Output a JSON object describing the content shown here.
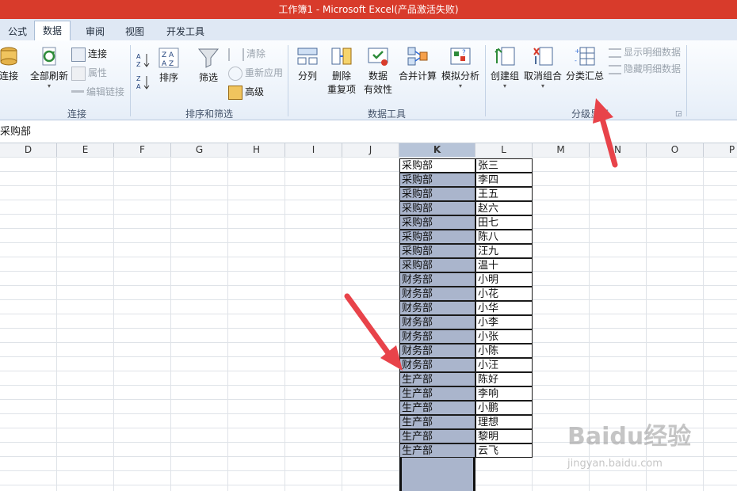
{
  "window": {
    "title": "工作簿1 - Microsoft Excel(产品激活失败)"
  },
  "tabs": [
    {
      "label": "公式"
    },
    {
      "label": "数据",
      "active": true
    },
    {
      "label": "审阅"
    },
    {
      "label": "视图"
    },
    {
      "label": "开发工具"
    }
  ],
  "ribbon": {
    "connections": {
      "left_connect": "连接",
      "refresh_all": "全部刷新",
      "connect": "连接",
      "properties": "属性",
      "edit_links": "编辑链接",
      "group_label": "连接"
    },
    "sort_filter": {
      "sort": "排序",
      "filter": "筛选",
      "clear": "清除",
      "reapply": "重新应用",
      "advanced": "高级",
      "group_label": "排序和筛选"
    },
    "data_tools": {
      "split": "分列",
      "remove_dup_1": "删除",
      "remove_dup_2": "重复项",
      "validation_1": "数据",
      "validation_2": "有效性",
      "consolidate": "合并计算",
      "what_if": "模拟分析",
      "group_label": "数据工具"
    },
    "outline": {
      "group": "创建组",
      "ungroup": "取消组合",
      "subtotal": "分类汇总",
      "show_detail": "显示明细数据",
      "hide_detail": "隐藏明细数据",
      "group_label": "分级显示"
    }
  },
  "formula_bar": {
    "value": "采购部"
  },
  "columns": [
    "D",
    "E",
    "F",
    "G",
    "H",
    "I",
    "J",
    "K",
    "L",
    "M",
    "N",
    "O",
    "P"
  ],
  "selected_column": "K",
  "table": {
    "rows": [
      {
        "dept": "采购部",
        "name": "张三"
      },
      {
        "dept": "采购部",
        "name": "李四"
      },
      {
        "dept": "采购部",
        "name": "王五"
      },
      {
        "dept": "采购部",
        "name": "赵六"
      },
      {
        "dept": "采购部",
        "name": "田七"
      },
      {
        "dept": "采购部",
        "name": "陈八"
      },
      {
        "dept": "采购部",
        "name": "汪九"
      },
      {
        "dept": "采购部",
        "name": "温十"
      },
      {
        "dept": "财务部",
        "name": "小明"
      },
      {
        "dept": "财务部",
        "name": "小花"
      },
      {
        "dept": "财务部",
        "name": "小华"
      },
      {
        "dept": "财务部",
        "name": "小李"
      },
      {
        "dept": "财务部",
        "name": "小张"
      },
      {
        "dept": "财务部",
        "name": "小陈"
      },
      {
        "dept": "财务部",
        "name": "小汪"
      },
      {
        "dept": "生产部",
        "name": "陈好"
      },
      {
        "dept": "生产部",
        "name": "李响"
      },
      {
        "dept": "生产部",
        "name": "小鹏"
      },
      {
        "dept": "生产部",
        "name": "理想"
      },
      {
        "dept": "生产部",
        "name": "黎明"
      },
      {
        "dept": "生产部",
        "name": "云飞"
      }
    ]
  },
  "watermark": {
    "brand": "Baidu经验",
    "url": "jingyan.baidu.com"
  },
  "colors": {
    "titlebar": "#d83b2b",
    "selection": "#aab5cc",
    "arrow": "#e8434a"
  }
}
